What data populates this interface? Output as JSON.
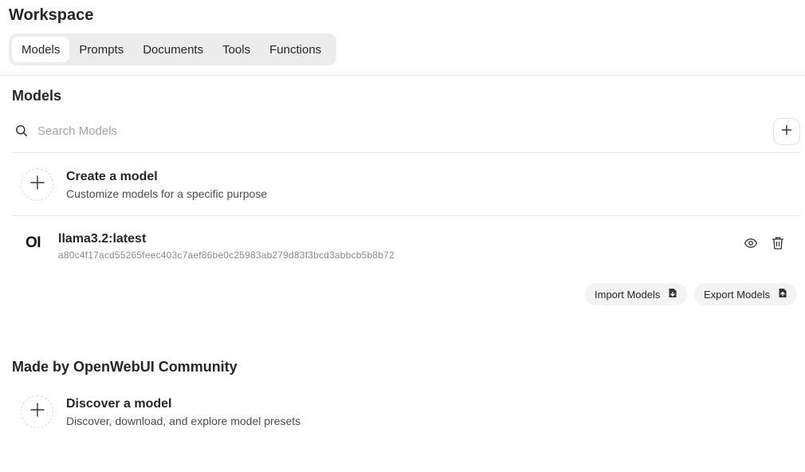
{
  "header": {
    "title": "Workspace"
  },
  "tabs": [
    {
      "label": "Models",
      "active": true
    },
    {
      "label": "Prompts",
      "active": false
    },
    {
      "label": "Documents",
      "active": false
    },
    {
      "label": "Tools",
      "active": false
    },
    {
      "label": "Functions",
      "active": false
    }
  ],
  "models_section": {
    "title": "Models",
    "search": {
      "placeholder": "Search Models",
      "value": ""
    },
    "create": {
      "title": "Create a model",
      "subtitle": "Customize models for a specific purpose"
    },
    "models": [
      {
        "logo": "OI",
        "name": "llama3.2:latest",
        "hash": "a80c4f17acd55265feec403c7aef86be0c25983ab279d83f3bcd3abbcb5b8b72"
      }
    ],
    "import_label": "Import Models",
    "export_label": "Export Models"
  },
  "community_section": {
    "title": "Made by OpenWebUI Community",
    "discover": {
      "title": "Discover a model",
      "subtitle": "Discover, download, and explore model presets"
    }
  },
  "icons": {
    "search": "search-icon",
    "add": "plus-icon",
    "view": "eye-icon",
    "delete": "trash-icon",
    "import": "file-import-icon",
    "export": "file-export-icon"
  }
}
